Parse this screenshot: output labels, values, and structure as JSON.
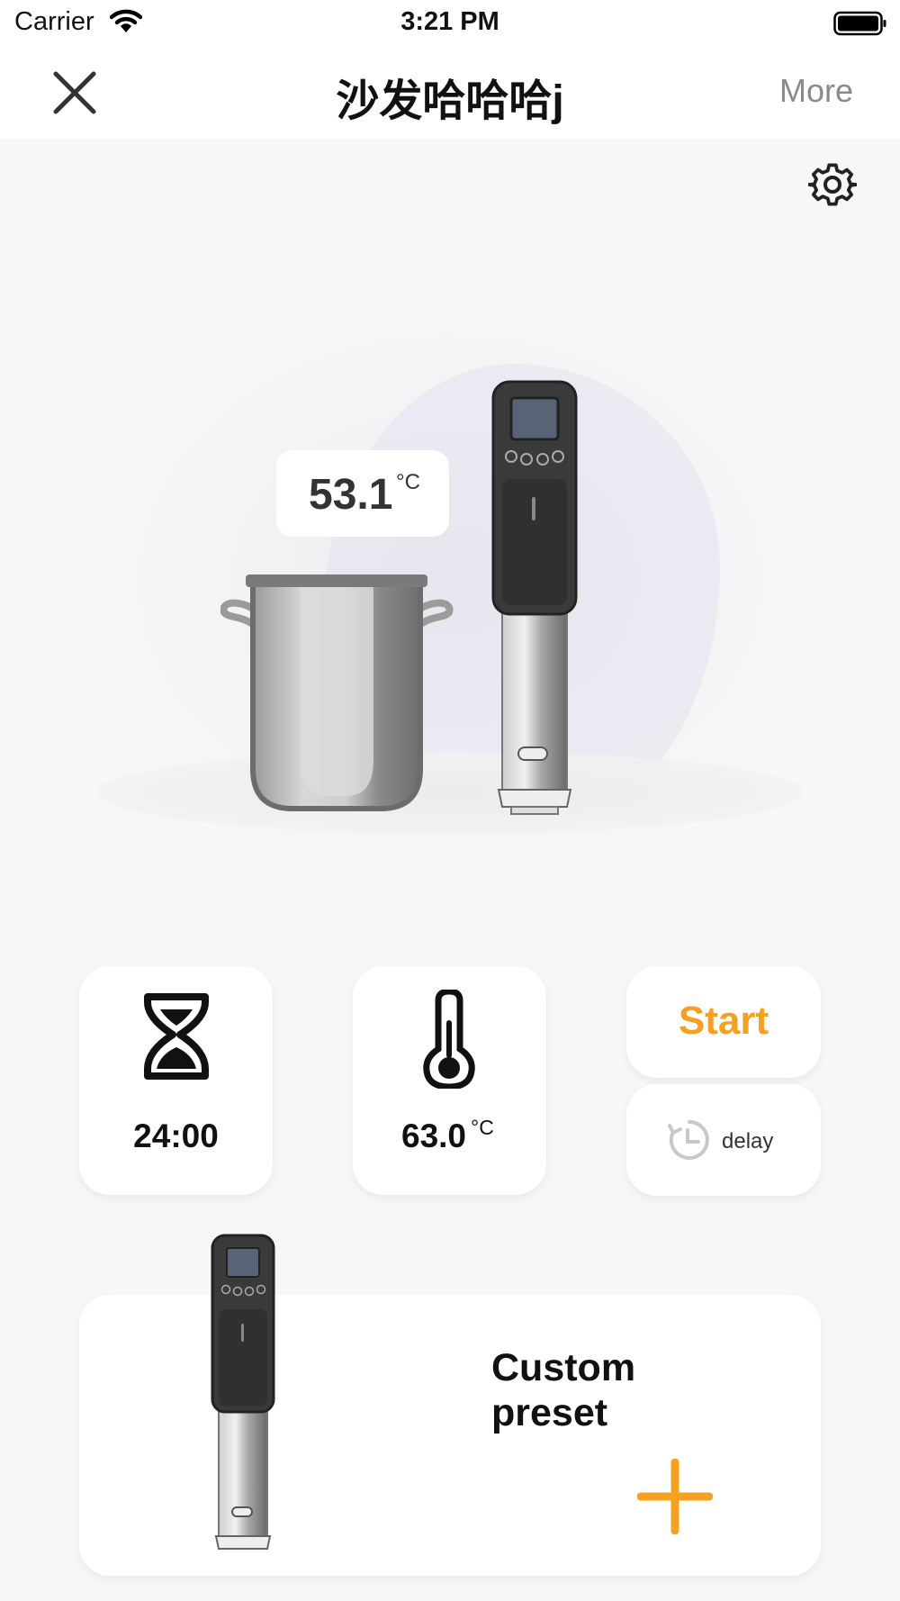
{
  "status_bar": {
    "carrier": "Carrier",
    "time": "3:21 PM"
  },
  "nav": {
    "title": "沙发哈哈哈j",
    "more_label": "More"
  },
  "device": {
    "current_temp": "53.1",
    "current_temp_unit": "°C"
  },
  "controls": {
    "timer_value": "24:00",
    "target_temp": "63.0",
    "target_temp_unit": "°C",
    "start_label": "Start",
    "delay_label": "delay"
  },
  "preset": {
    "label": "Custom preset"
  },
  "colors": {
    "accent": "#f5a020",
    "background": "#f7f7f7",
    "card": "#ffffff"
  },
  "icons": [
    "wifi-icon",
    "battery-icon",
    "close-icon",
    "gear-icon",
    "hourglass-icon",
    "thermometer-icon",
    "delay-clock-icon",
    "plus-icon"
  ]
}
